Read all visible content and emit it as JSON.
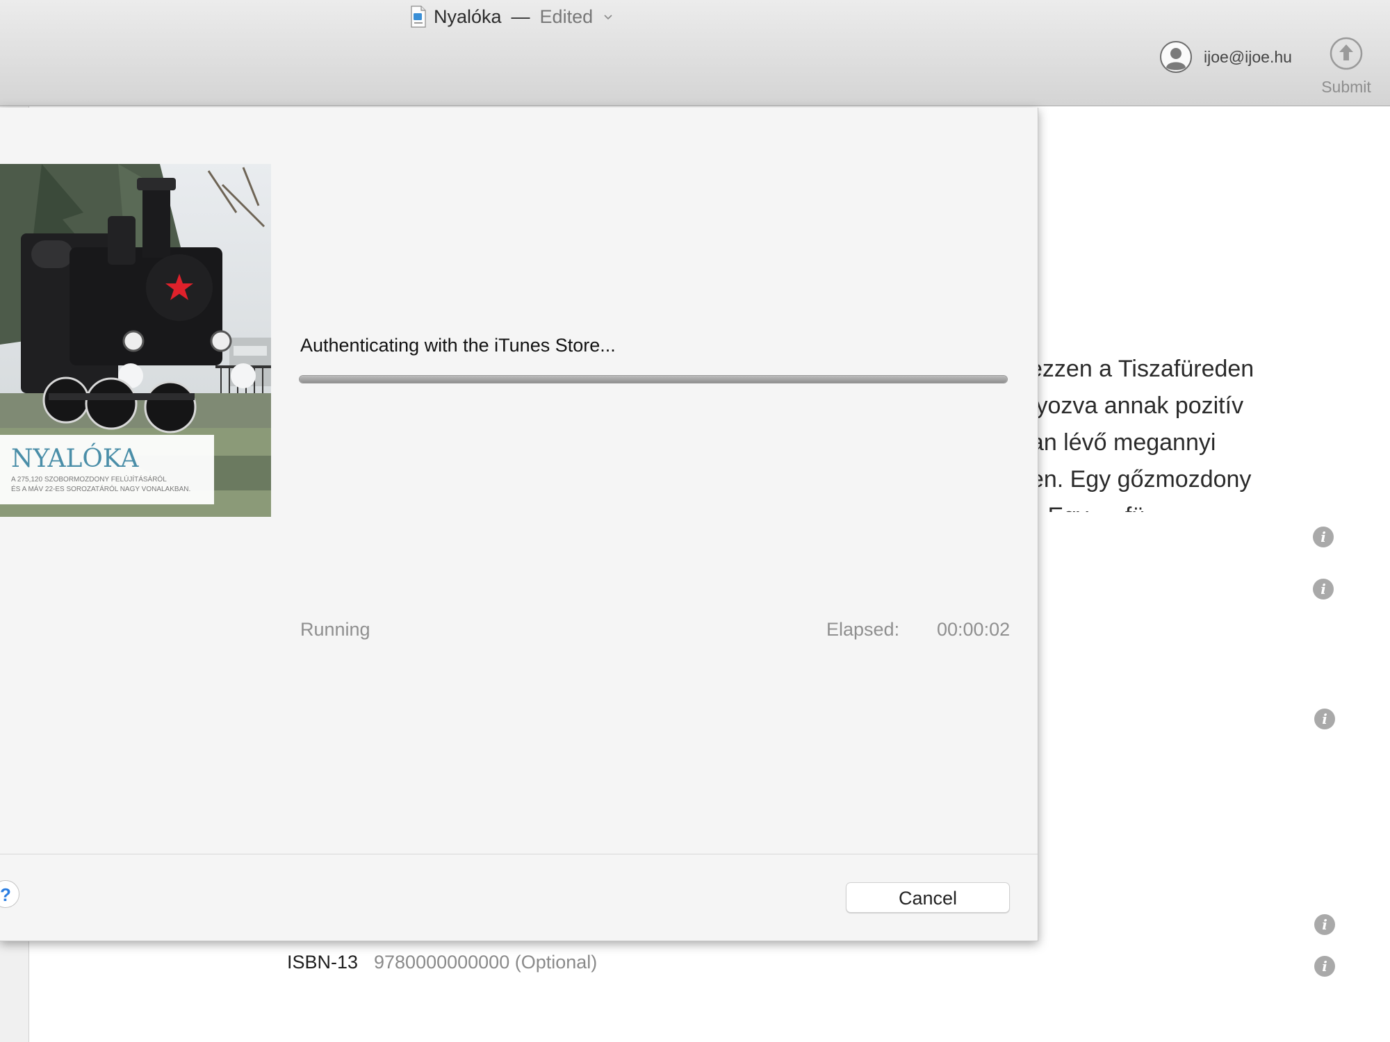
{
  "window": {
    "title": "Nyalóka",
    "title_separator": "—",
    "title_state": "Edited",
    "doc_icon": "ibooks-document-icon"
  },
  "toolbar": {
    "account_email": "ijoe@ijoe.hu",
    "account_icon": "user-avatar-icon",
    "submit_label": "Submit",
    "submit_icon": "upload-arrow-icon"
  },
  "background": {
    "body_lines": [
      "kezzen a Tiszafüreden",
      "úlyozva annak pozitív",
      "ban lévő megannyi",
      "ben. Egy gőzmozdony",
      "… Egy … fü …"
    ],
    "isbn_label": "ISBN-13",
    "isbn_placeholder": "9780000000000 (Optional)"
  },
  "dialog": {
    "cover": {
      "title": "NYALÓKA",
      "subtitle_line1": "A 275,120 SZOBORMOZDONY FELÚJÍTÁSÁRÓL",
      "subtitle_line2": "ÉS A MÁV 22-ES SOROZATÁRÓL NAGY VONALAKBAN."
    },
    "status_message": "Authenticating with the iTunes Store...",
    "progress": 1.0,
    "state": "Running",
    "elapsed_label": "Elapsed:",
    "elapsed_value": "00:00:02",
    "help_label": "?",
    "cancel_label": "Cancel"
  },
  "colors": {
    "cover_title": "#4a8ea8",
    "star": "#e0212b",
    "help_blue": "#2a7de1"
  }
}
